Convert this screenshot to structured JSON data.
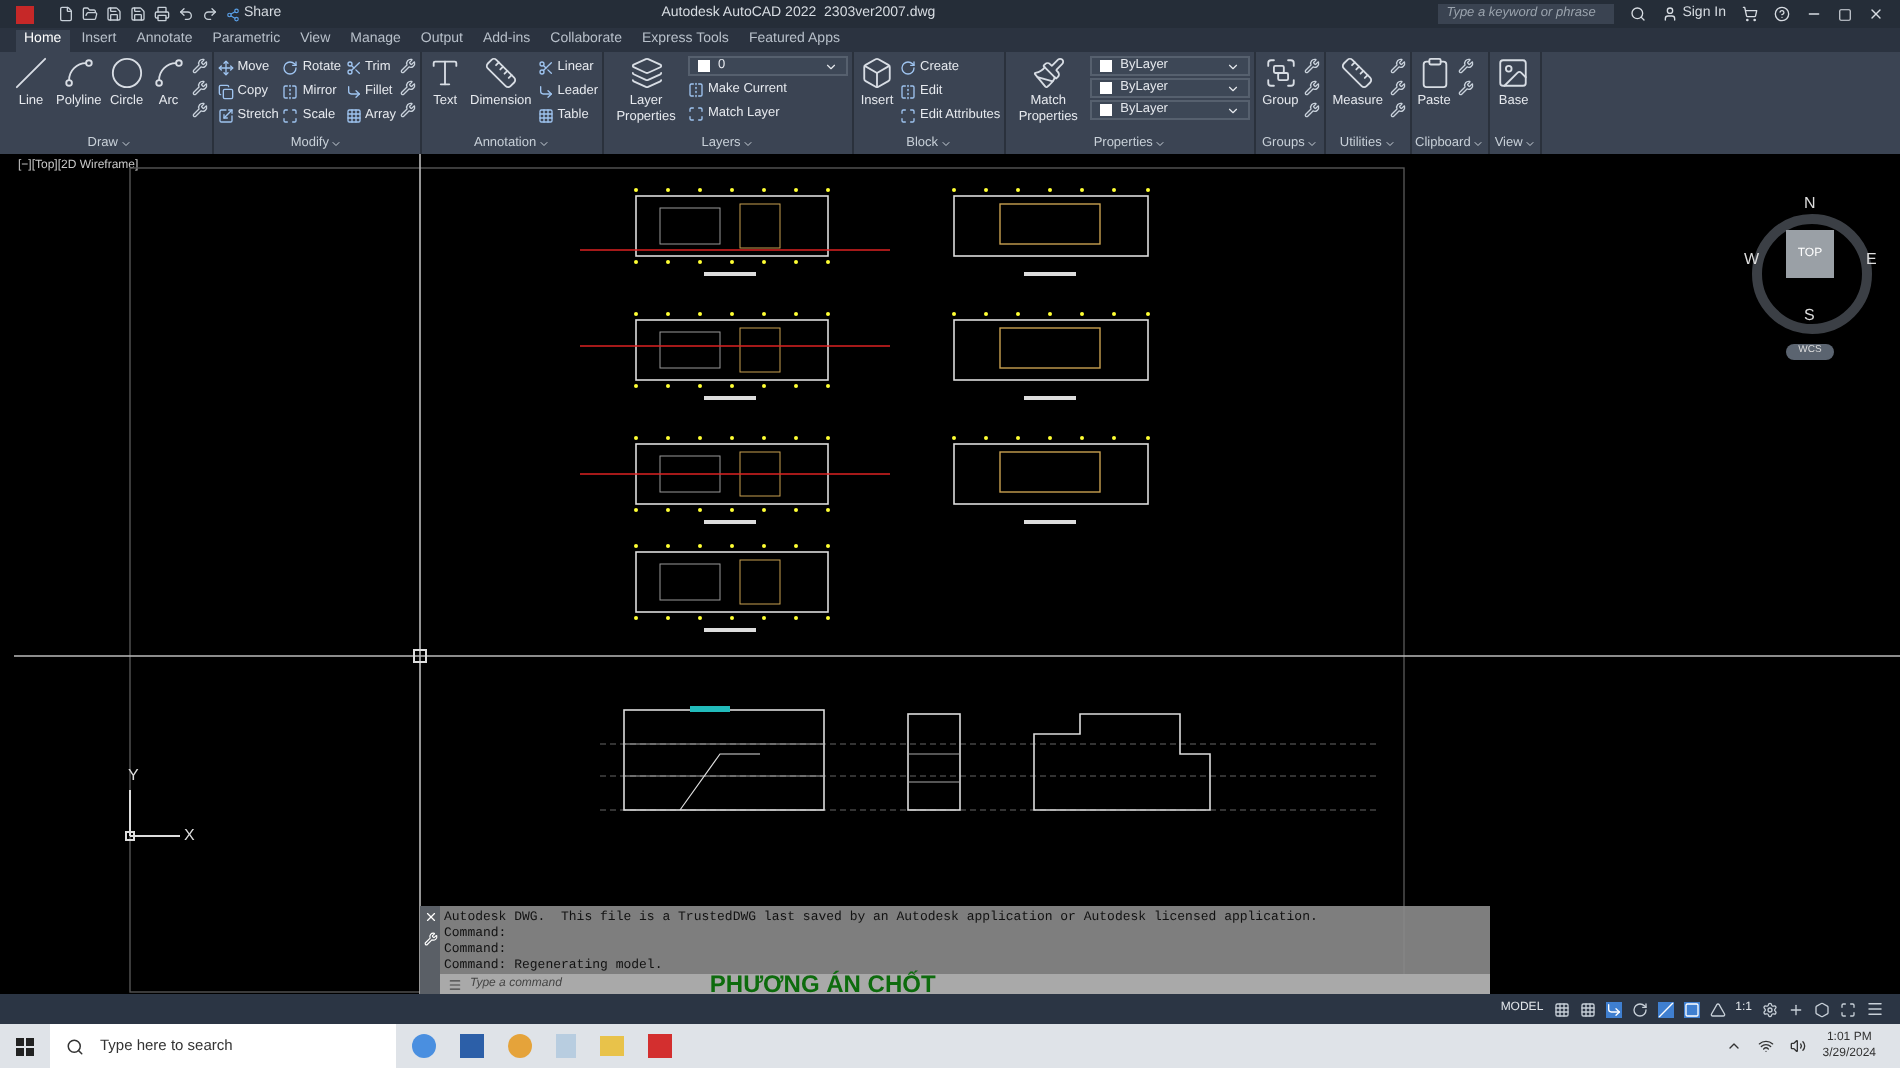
{
  "title_bar": {
    "share": "Share",
    "app_title": "Autodesk AutoCAD 2022",
    "file_name": "2303ver2007.dwg",
    "search_placeholder": "Type a keyword or phrase",
    "sign_in": "Sign In"
  },
  "tabs": [
    {
      "label": "Home",
      "selected": true
    },
    {
      "label": "Insert",
      "selected": false
    },
    {
      "label": "Annotate",
      "selected": false
    },
    {
      "label": "Parametric",
      "selected": false
    },
    {
      "label": "View",
      "selected": false
    },
    {
      "label": "Manage",
      "selected": false
    },
    {
      "label": "Output",
      "selected": false
    },
    {
      "label": "Add-ins",
      "selected": false
    },
    {
      "label": "Collaborate",
      "selected": false
    },
    {
      "label": "Express Tools",
      "selected": false
    },
    {
      "label": "Featured Apps",
      "selected": false
    }
  ],
  "ribbon_panels": [
    {
      "title": "Draw",
      "columns": [
        [
          {
            "kind": "large",
            "label": "Line"
          }
        ],
        [
          {
            "kind": "large",
            "label": "Polyline"
          }
        ],
        [
          {
            "kind": "large",
            "label": "Circle"
          }
        ],
        [
          {
            "kind": "large",
            "label": "Arc"
          }
        ],
        [
          {
            "kind": "icon"
          },
          {
            "kind": "icon"
          },
          {
            "kind": "icon"
          }
        ]
      ]
    },
    {
      "title": "Modify",
      "columns": [
        [
          {
            "kind": "small",
            "label": "Move"
          },
          {
            "kind": "small",
            "label": "Copy"
          },
          {
            "kind": "small",
            "label": "Stretch"
          }
        ],
        [
          {
            "kind": "small",
            "label": "Rotate"
          },
          {
            "kind": "small",
            "label": "Mirror"
          },
          {
            "kind": "small",
            "label": "Scale"
          }
        ],
        [
          {
            "kind": "small",
            "label": "Trim"
          },
          {
            "kind": "small",
            "label": "Fillet"
          },
          {
            "kind": "small",
            "label": "Array"
          }
        ],
        [
          {
            "kind": "icon"
          },
          {
            "kind": "icon"
          },
          {
            "kind": "icon"
          }
        ]
      ]
    },
    {
      "title": "Annotation",
      "columns": [
        [
          {
            "kind": "large",
            "label": "Text"
          }
        ],
        [
          {
            "kind": "large",
            "label": "Dimension"
          }
        ],
        [
          {
            "kind": "small",
            "label": "Linear"
          },
          {
            "kind": "small",
            "label": "Leader"
          },
          {
            "kind": "small",
            "label": "Table"
          }
        ]
      ]
    },
    {
      "title": "Layers",
      "columns": [
        [
          {
            "kind": "large",
            "label": "Layer Properties"
          }
        ],
        [
          {
            "kind": "dropdown",
            "label": "0"
          },
          {
            "kind": "small",
            "label": "Make Current"
          },
          {
            "kind": "small",
            "label": "Match Layer"
          }
        ]
      ]
    },
    {
      "title": "Block",
      "columns": [
        [
          {
            "kind": "large",
            "label": "Insert"
          }
        ],
        [
          {
            "kind": "small",
            "label": "Create"
          },
          {
            "kind": "small",
            "label": "Edit"
          },
          {
            "kind": "small",
            "label": "Edit Attributes"
          }
        ]
      ]
    },
    {
      "title": "Properties",
      "columns": [
        [
          {
            "kind": "large",
            "label": "Match Properties"
          }
        ],
        [
          {
            "kind": "dropdown",
            "label": "ByLayer"
          },
          {
            "kind": "dropdown",
            "label": "ByLayer"
          },
          {
            "kind": "dropdown",
            "label": "ByLayer"
          }
        ]
      ]
    },
    {
      "title": "Groups",
      "columns": [
        [
          {
            "kind": "large",
            "label": "Group"
          }
        ],
        [
          {
            "kind": "icon"
          },
          {
            "kind": "icon"
          },
          {
            "kind": "icon"
          }
        ]
      ]
    },
    {
      "title": "Utilities",
      "columns": [
        [
          {
            "kind": "large",
            "label": "Measure"
          }
        ],
        [
          {
            "kind": "icon"
          },
          {
            "kind": "icon"
          },
          {
            "kind": "icon"
          }
        ]
      ]
    },
    {
      "title": "Clipboard",
      "columns": [
        [
          {
            "kind": "large",
            "label": "Paste"
          }
        ],
        [
          {
            "kind": "icon"
          },
          {
            "kind": "icon"
          }
        ]
      ]
    },
    {
      "title": "View",
      "columns": [
        [
          {
            "kind": "large",
            "label": "Base"
          }
        ]
      ]
    }
  ],
  "viewport_label": "[−][Top][2D Wireframe]",
  "drawing_text": "PHƯƠNG ÁN CHỐT",
  "view_cube": {
    "top": "TOP",
    "north": "N",
    "south": "S",
    "east": "E",
    "west": "W",
    "wcs": "WCS"
  },
  "ucs": {
    "x": "X",
    "y": "Y"
  },
  "command_history": [
    "Autodesk DWG.  This file is a TrustedDWG last saved by an Autodesk application or Autodesk licensed application.",
    "Command:",
    "Command:",
    "Command: Regenerating model."
  ],
  "command_placeholder": "Type a command",
  "status_bar": {
    "model": "MODEL",
    "scale": "1:1"
  },
  "taskbar": {
    "search_placeholder": "Type here to search",
    "time": "1:01 PM",
    "date": "3/29/2024"
  }
}
